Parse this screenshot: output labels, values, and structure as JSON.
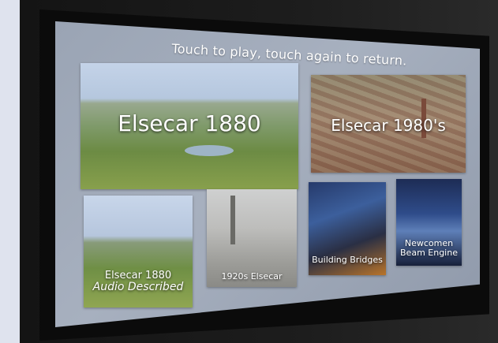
{
  "screen": {
    "instruction": "Touch to play, touch again to return."
  },
  "tiles": [
    {
      "label": "Elsecar 1880"
    },
    {
      "label": "Elsecar 1980's"
    },
    {
      "label_line1": "Elsecar 1880",
      "label_line2": "Audio Described"
    },
    {
      "label": "1920s Elsecar"
    },
    {
      "label": "Building Bridges"
    },
    {
      "label_line1": "Newcomen",
      "label_line2": "Beam Engine"
    }
  ]
}
